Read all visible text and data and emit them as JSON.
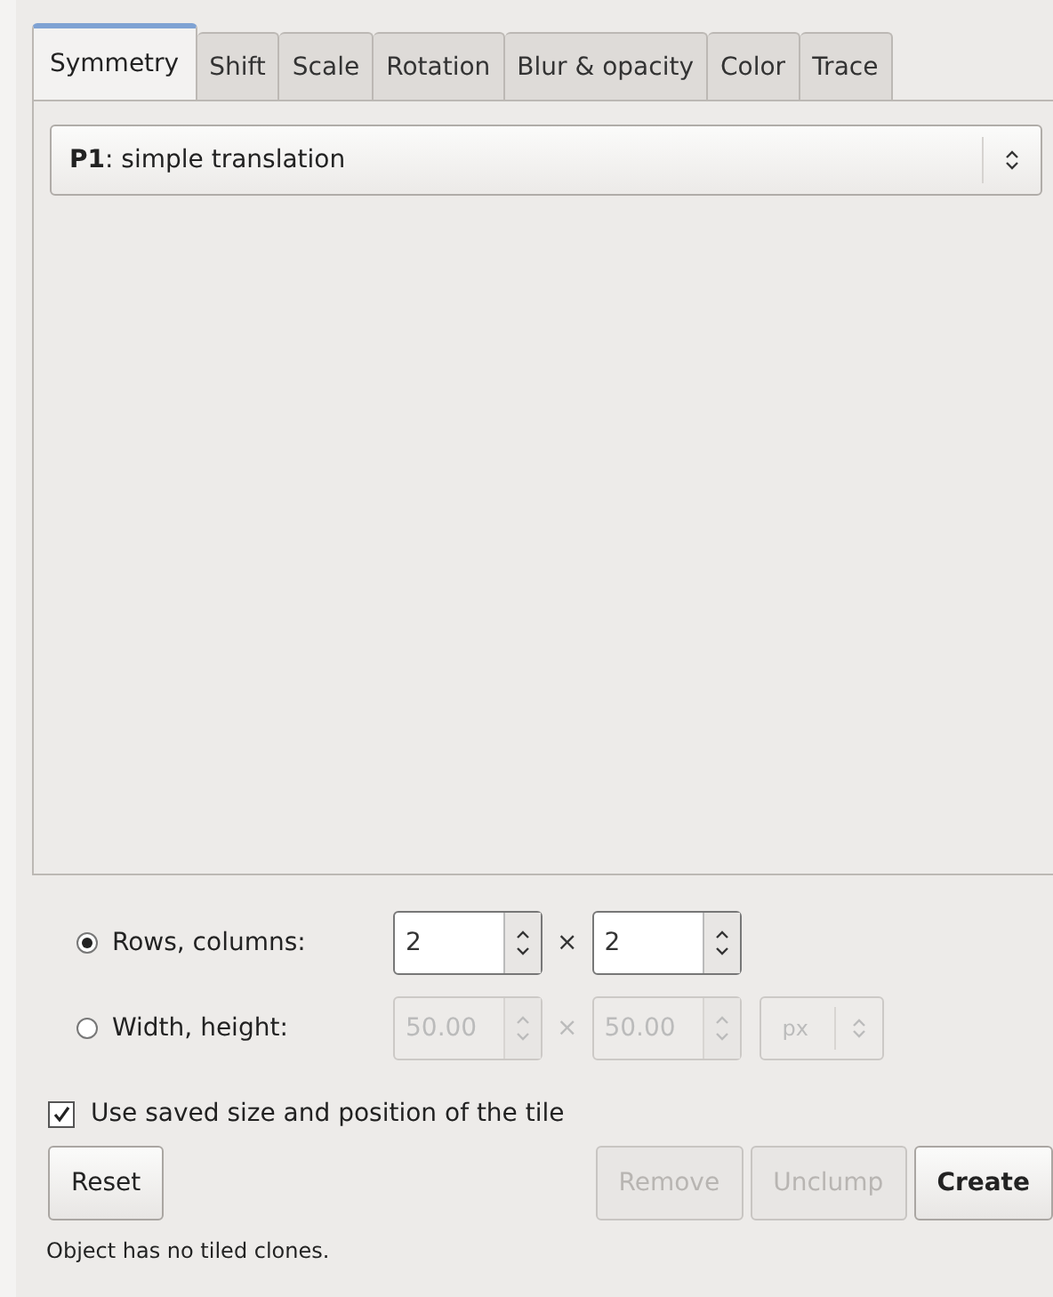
{
  "tabs": [
    {
      "label": "Symmetry",
      "selected": true
    },
    {
      "label": "Shift",
      "selected": false
    },
    {
      "label": "Scale",
      "selected": false
    },
    {
      "label": "Rotation",
      "selected": false
    },
    {
      "label": "Blur & opacity",
      "selected": false
    },
    {
      "label": "Color",
      "selected": false
    },
    {
      "label": "Trace",
      "selected": false
    }
  ],
  "symmetry_select": {
    "value": "**P1**: simple translation"
  },
  "size_options": [
    {
      "label": "Rows, columns:",
      "selected": true,
      "first": "2",
      "second": "2",
      "disabled": false
    },
    {
      "label": "Width, height:",
      "selected": false,
      "first": "50.00",
      "second": "50.00",
      "disabled": true,
      "unit": "px"
    }
  ],
  "times_sign": "×",
  "use_saved": {
    "label": "Use saved size and position of the tile",
    "checked": true
  },
  "buttons": [
    {
      "label": "Reset",
      "disabled": false,
      "bold": false
    },
    {
      "label": "Remove",
      "disabled": true,
      "bold": false
    },
    {
      "label": "Unclump",
      "disabled": true,
      "bold": false
    },
    {
      "label": "Create",
      "disabled": false,
      "bold": true
    }
  ],
  "status": "Object has no tiled clones."
}
